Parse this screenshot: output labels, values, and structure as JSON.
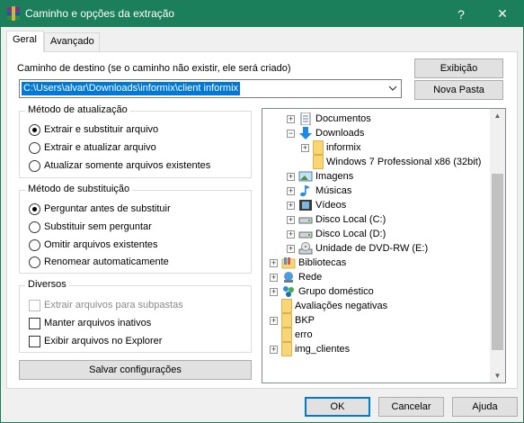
{
  "window": {
    "title": "Caminho e opções da extração",
    "help_glyph": "?",
    "close_glyph": "✕"
  },
  "tabs": [
    {
      "label": "Geral"
    },
    {
      "label": "Avançado"
    }
  ],
  "destination": {
    "label": "Caminho de destino (se o caminho não existir, ele será criado)",
    "value": "C:\\Users\\alvar\\Downloads\\informix\\client informix"
  },
  "buttons": {
    "view": "Exibição",
    "new_folder": "Nova Pasta",
    "save_settings": "Salvar configurações",
    "ok": "OK",
    "cancel": "Cancelar",
    "help": "Ajuda"
  },
  "update_mode": {
    "title": "Método de atualização",
    "options": [
      {
        "label": "Extrair e substituir arquivo",
        "checked": true
      },
      {
        "label": "Extrair e atualizar arquivo",
        "checked": false
      },
      {
        "label": "Atualizar somente arquivos existentes",
        "checked": false
      }
    ]
  },
  "overwrite_mode": {
    "title": "Método de substituição",
    "options": [
      {
        "label": "Perguntar antes de substituir",
        "checked": true
      },
      {
        "label": "Substituir sem perguntar",
        "checked": false
      },
      {
        "label": "Omitir arquivos existentes",
        "checked": false
      },
      {
        "label": "Renomear automaticamente",
        "checked": false
      }
    ]
  },
  "misc": {
    "title": "Diversos",
    "options": [
      {
        "label": "Extrair arquivos para subpastas",
        "checked": false,
        "disabled": true
      },
      {
        "label": "Manter arquivos inativos",
        "checked": false,
        "disabled": false
      },
      {
        "label": "Exibir arquivos no Explorer",
        "checked": false,
        "disabled": false
      }
    ]
  },
  "tree": {
    "items": [
      {
        "label": "Documentos",
        "icon": "documents-icon",
        "expander": "+"
      },
      {
        "label": "Downloads",
        "icon": "downloads-icon",
        "expander": "−"
      },
      {
        "label": "informix",
        "icon": "folder-icon",
        "expander": "+"
      },
      {
        "label": "Windows 7 Professional x86 (32bit)",
        "icon": "folder-icon",
        "expander": ""
      },
      {
        "label": "Imagens",
        "icon": "pictures-icon",
        "expander": "+"
      },
      {
        "label": "Músicas",
        "icon": "music-icon",
        "expander": "+"
      },
      {
        "label": "Vídeos",
        "icon": "videos-icon",
        "expander": "+"
      },
      {
        "label": "Disco Local (C:)",
        "icon": "drive-icon",
        "expander": "+"
      },
      {
        "label": "Disco Local (D:)",
        "icon": "drive-icon",
        "expander": "+"
      },
      {
        "label": "Unidade de DVD-RW (E:)",
        "icon": "dvd-drive-icon",
        "expander": "+"
      },
      {
        "label": "Bibliotecas",
        "icon": "libraries-icon",
        "expander": "+"
      },
      {
        "label": "Rede",
        "icon": "network-icon",
        "expander": "+"
      },
      {
        "label": "Grupo doméstico",
        "icon": "homegroup-icon",
        "expander": "+"
      },
      {
        "label": "Avaliações negativas",
        "icon": "folder-icon",
        "expander": ""
      },
      {
        "label": "BKP",
        "icon": "folder-icon",
        "expander": "+"
      },
      {
        "label": "erro",
        "icon": "folder-icon",
        "expander": ""
      },
      {
        "label": "img_clientes",
        "icon": "folder-icon",
        "expander": "+"
      }
    ]
  },
  "colors": {
    "titlebar": "#1a7f5a",
    "selection": "#0078d7",
    "folder": "#f8d675",
    "download_arrow": "#1e88e5"
  }
}
